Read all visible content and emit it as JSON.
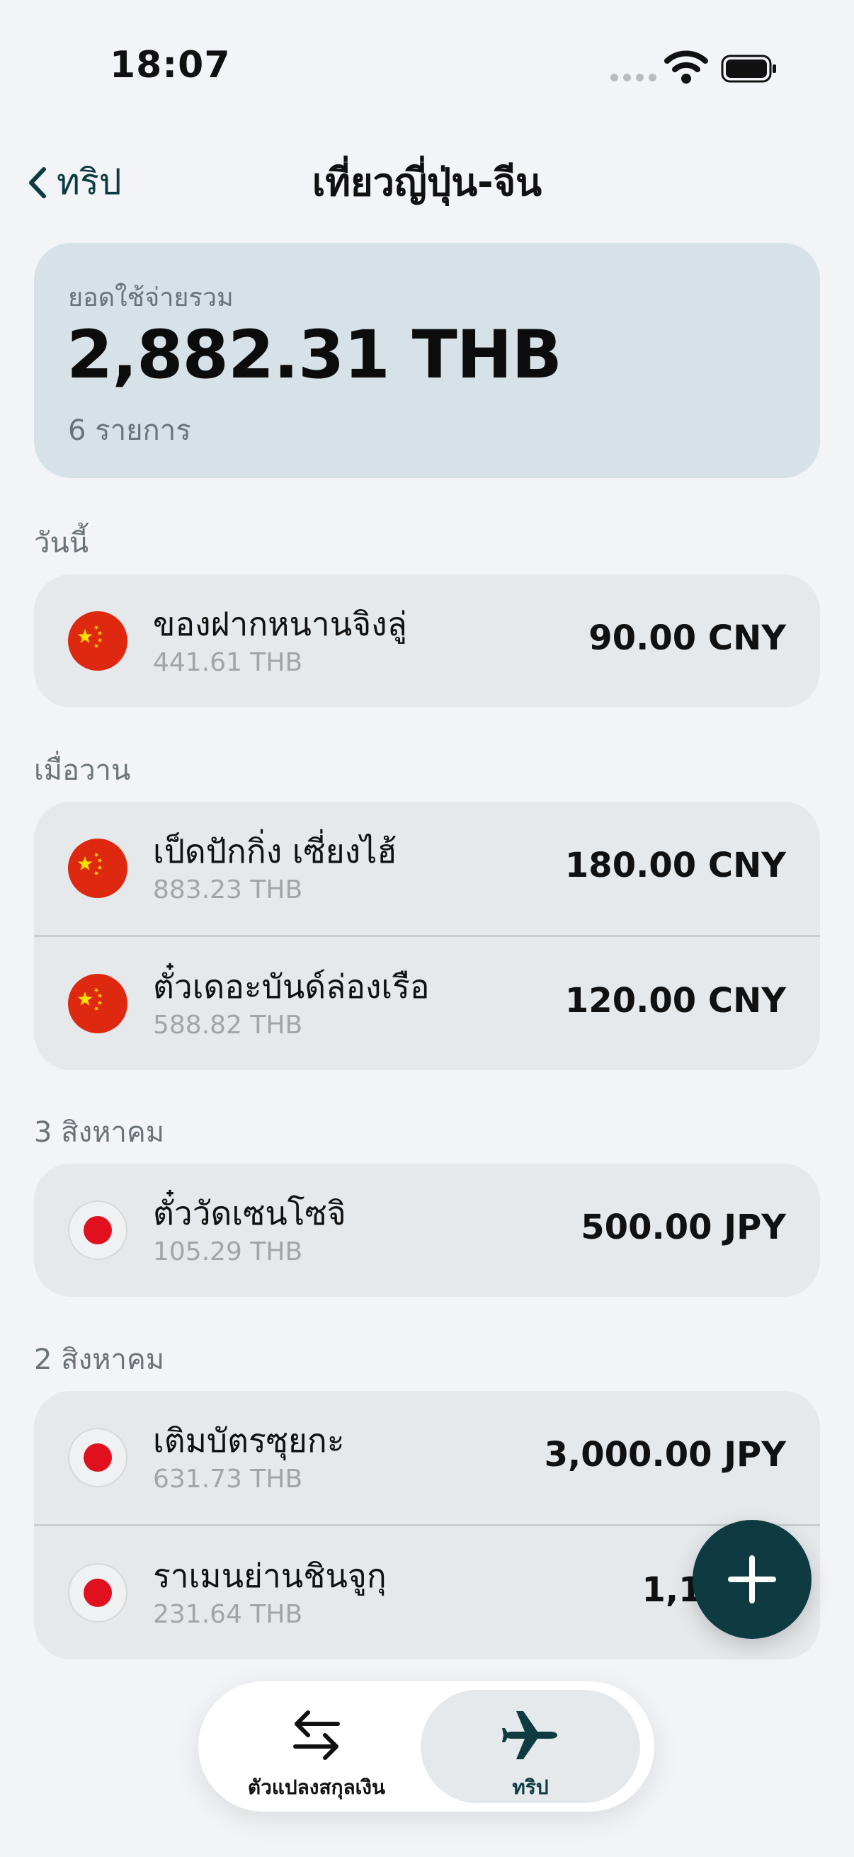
{
  "status_bar": {
    "time": "18:07"
  },
  "nav": {
    "back_label": "ทริป",
    "title": "เที่ยวญี่ปุ่น-จีน"
  },
  "summary": {
    "label": "ยอดใช้จ่ายรวม",
    "total": "2,882.31 THB",
    "count": "6 รายการ"
  },
  "sections": [
    {
      "label": "วันนี้",
      "items": [
        {
          "flag": "china-flag",
          "name": "ของฝากหนานจิงลู่",
          "converted": "441.61 THB",
          "amount": "90.00 CNY"
        }
      ]
    },
    {
      "label": "เมื่อวาน",
      "items": [
        {
          "flag": "china-flag",
          "name": "เป็ดปักกิ่ง เซี่ยงไฮ้",
          "converted": "883.23 THB",
          "amount": "180.00 CNY"
        },
        {
          "flag": "china-flag",
          "name": "ตั๋วเดอะบันด์ล่องเรือ",
          "converted": "588.82 THB",
          "amount": "120.00 CNY"
        }
      ]
    },
    {
      "label": "3 สิงหาคม",
      "items": [
        {
          "flag": "japan-flag",
          "name": "ตั๋ววัดเซนโซจิ",
          "converted": "105.29 THB",
          "amount": "500.00 JPY"
        }
      ]
    },
    {
      "label": "2 สิงหาคม",
      "items": [
        {
          "flag": "japan-flag",
          "name": "เติมบัตรซุยกะ",
          "converted": "631.73 THB",
          "amount": "3,000.00 JPY"
        },
        {
          "flag": "japan-flag",
          "name": "ราเมนย่านชินจูกุ",
          "converted": "231.64 THB",
          "amount": "1,100.0"
        }
      ]
    }
  ],
  "fab": {
    "icon": "plus-icon"
  },
  "tabbar": {
    "tabs": [
      {
        "label": "ตัวแปลงสกุลเงิน",
        "icon": "swap-arrows-icon",
        "selected": false
      },
      {
        "label": "ทริป",
        "icon": "airplane-icon",
        "selected": true
      }
    ]
  },
  "colors": {
    "accent": "#0e3b41",
    "summary_bg": "#d6e2e7",
    "card_bg": "#e6e9ec",
    "page_bg": "#f2f4f7"
  }
}
